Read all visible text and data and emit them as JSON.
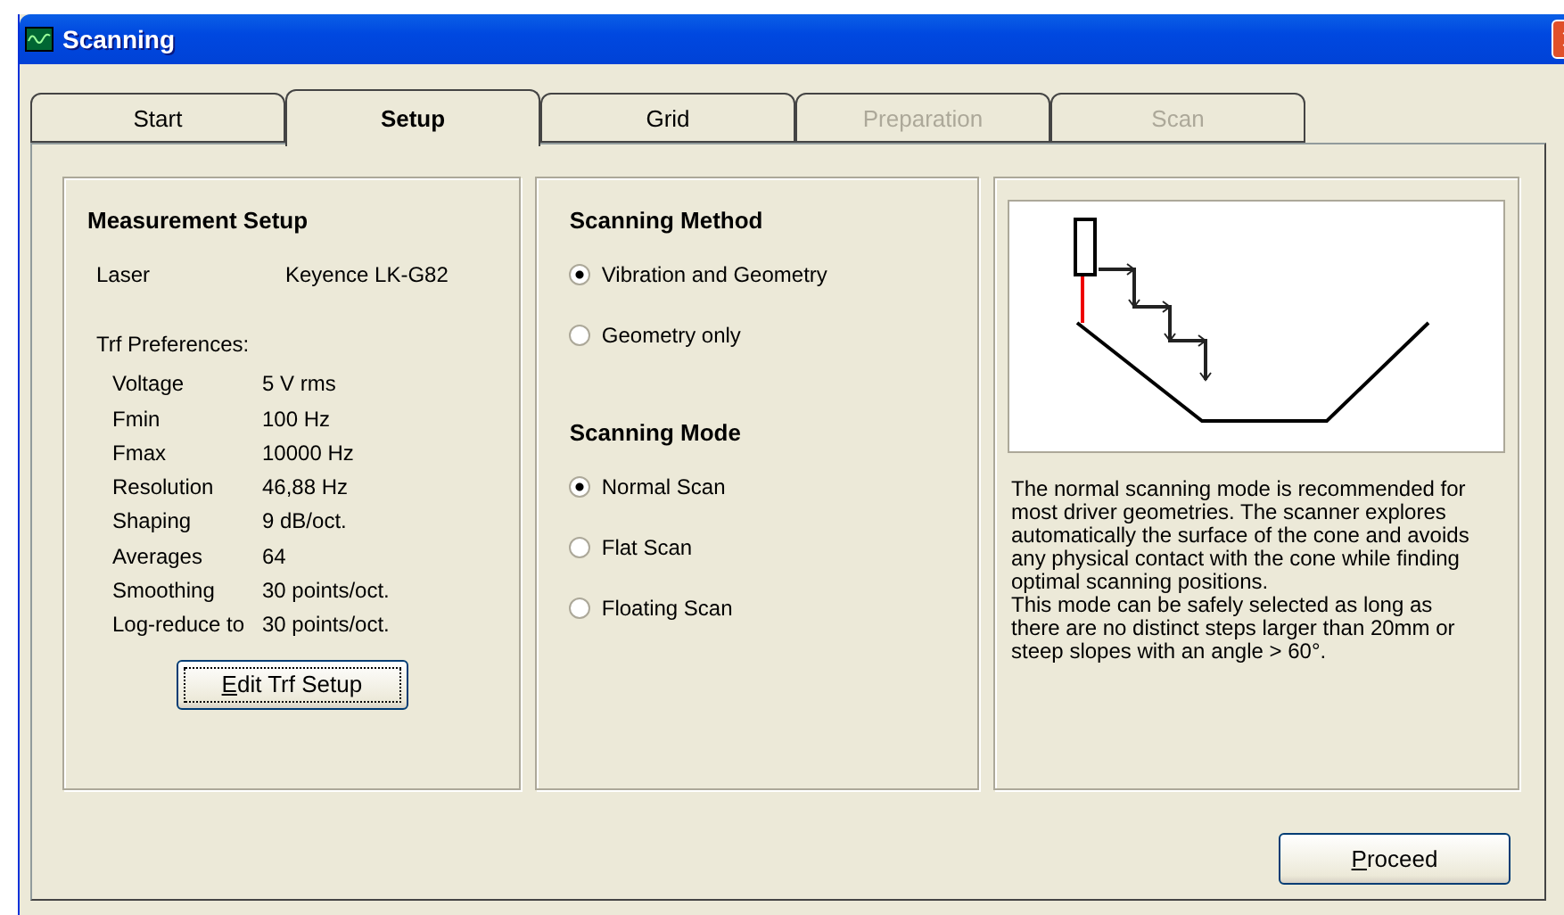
{
  "window": {
    "title": "Scanning"
  },
  "tabs": [
    {
      "label": "Start",
      "selected": false,
      "disabled": false
    },
    {
      "label": "Setup",
      "selected": true,
      "disabled": false
    },
    {
      "label": "Grid",
      "selected": false,
      "disabled": false
    },
    {
      "label": "Preparation",
      "selected": false,
      "disabled": true
    },
    {
      "label": "Scan",
      "selected": false,
      "disabled": true
    }
  ],
  "measurement_setup": {
    "title": "Measurement Setup",
    "laser": {
      "label": "Laser",
      "value": "Keyence LK-G82"
    },
    "preferences_label": "Trf Preferences:",
    "preferences": [
      {
        "label": "Voltage",
        "value": "5 V rms"
      },
      {
        "label": "Fmin",
        "value": "100 Hz"
      },
      {
        "label": "Fmax",
        "value": "10000 Hz"
      },
      {
        "label": "Resolution",
        "value": "46,88 Hz"
      },
      {
        "label": "Shaping",
        "value": "9 dB/oct."
      },
      {
        "label": "Averages",
        "value": "64"
      },
      {
        "label": "Smoothing",
        "value": "30 points/oct."
      },
      {
        "label": "Log-reduce to",
        "value": "30 points/oct."
      }
    ],
    "button": {
      "label": "Edit Trf Setup",
      "focused": true
    }
  },
  "scanning_method": {
    "title": "Scanning Method",
    "options": [
      {
        "label": "Vibration and Geometry",
        "selected": true
      },
      {
        "label": "Geometry only",
        "selected": false
      }
    ]
  },
  "scanning_mode": {
    "title": "Scanning Mode",
    "options": [
      {
        "label": "Normal Scan",
        "selected": true
      },
      {
        "label": "Flat Scan",
        "selected": false
      },
      {
        "label": "Floating Scan",
        "selected": false
      }
    ]
  },
  "description": "The normal scanning mode is recommended for most driver geometries. The scanner explores automatically the surface of the cone and avoids any physical contact with the cone while finding optimal scanning positions.\nThis mode can be safely selected as long as there are no distinct steps larger than 20mm or steep slopes with an angle > 60°.",
  "proceed_button": {
    "label": "Proceed"
  }
}
